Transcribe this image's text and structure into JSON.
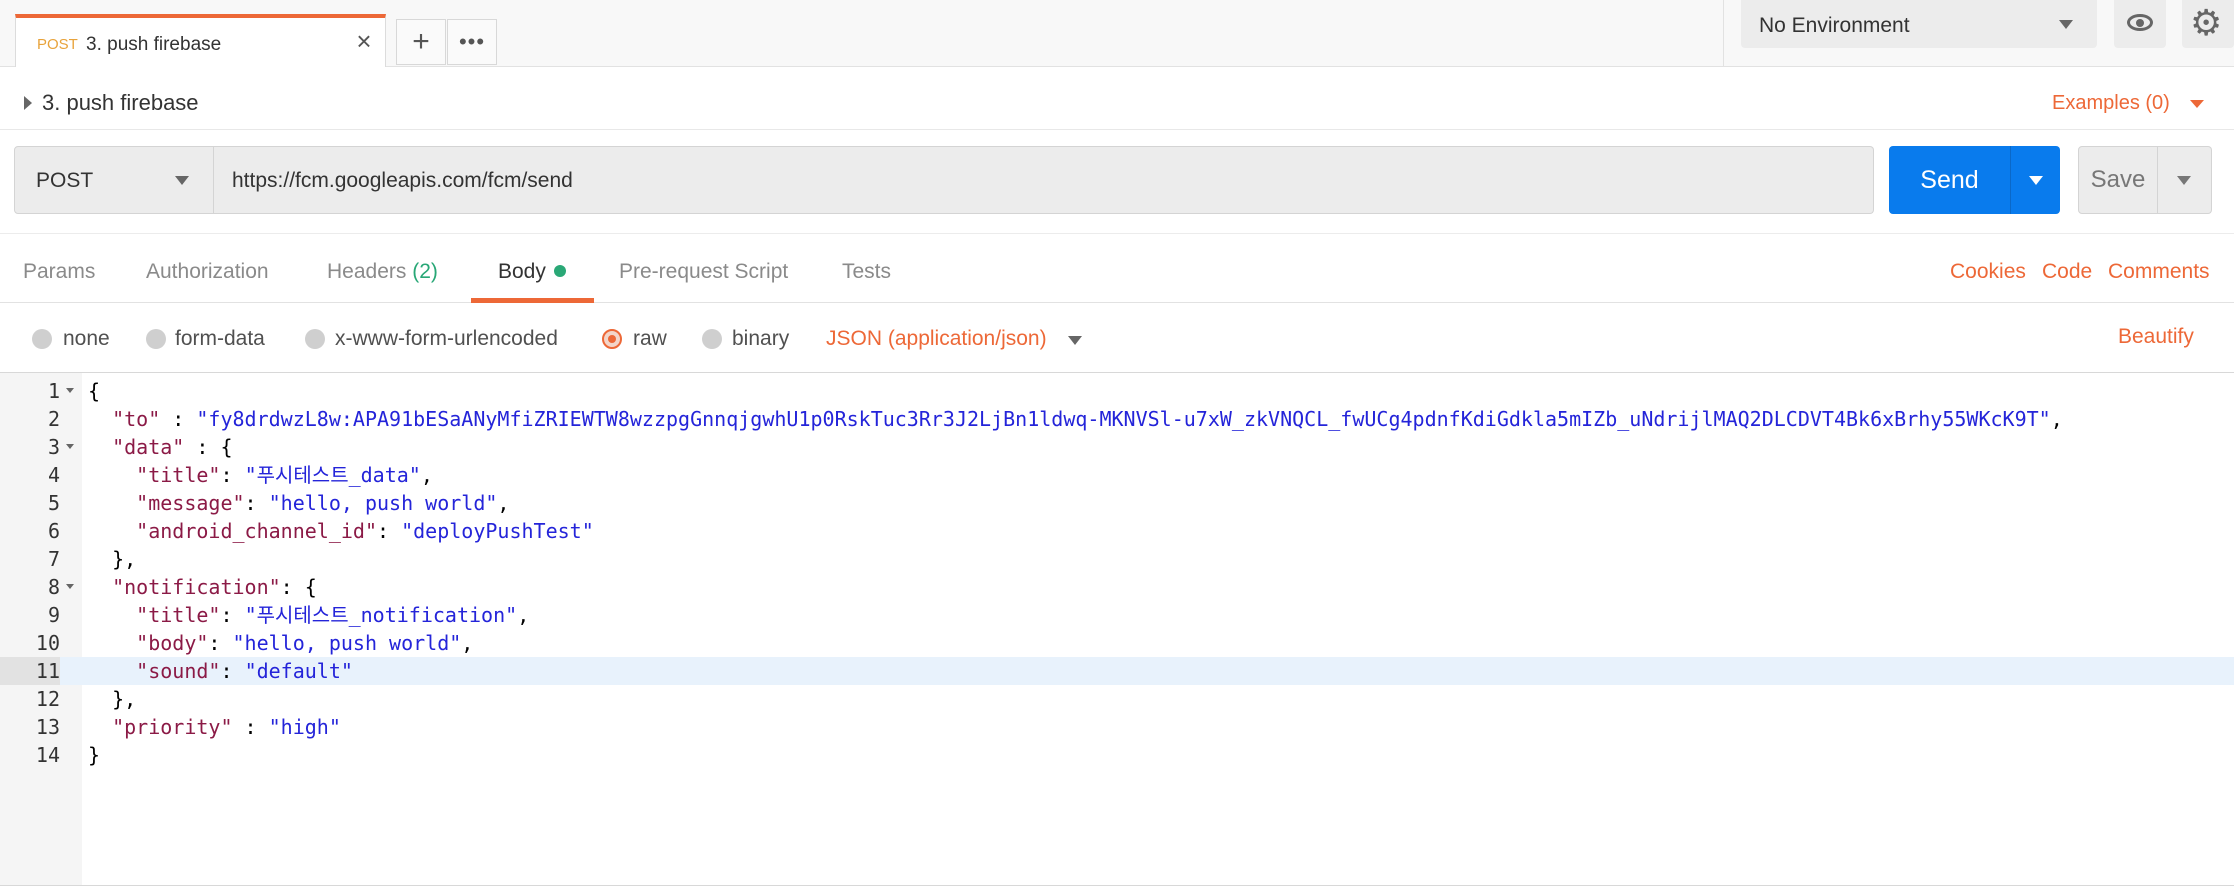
{
  "tab": {
    "method": "POST",
    "name": "3. push firebase"
  },
  "environment": {
    "label": "No Environment"
  },
  "request": {
    "title": "3. push firebase",
    "examples": "Examples (0)",
    "method": "POST",
    "url": "https://fcm.googleapis.com/fcm/send",
    "send": "Send",
    "save": "Save"
  },
  "reqtabs": {
    "params": "Params",
    "authorization": "Authorization",
    "headers": "Headers",
    "headers_count": "(2)",
    "body": "Body",
    "prerequest": "Pre-request Script",
    "tests": "Tests",
    "cookies": "Cookies",
    "code": "Code",
    "comments": "Comments"
  },
  "bodytypes": {
    "none": "none",
    "formdata": "form-data",
    "urlencoded": "x-www-form-urlencoded",
    "raw": "raw",
    "binary": "binary",
    "json": "JSON (application/json)",
    "beautify": "Beautify"
  },
  "editor": {
    "lines": [
      {
        "n": "1",
        "fold": true,
        "parts": [
          [
            "p",
            "{"
          ]
        ]
      },
      {
        "n": "2",
        "fold": false,
        "parts": [
          [
            "p",
            "  "
          ],
          [
            "k",
            "\"to\""
          ],
          [
            "p",
            " : "
          ],
          [
            "s",
            "\"fy8drdwzL8w:APA91bESaANyMfiZRIEWTW8wzzpgGnnqjgwhU1p0RskTuc3Rr3J2LjBn1ldwq-MKNVSl-u7xW_zkVNQCL_fwUCg4pdnfKdiGdkla5mIZb_uNdrijlMAQ2DLCDVT4Bk6xBrhy55WKcK9T\""
          ],
          [
            "p",
            ","
          ]
        ]
      },
      {
        "n": "3",
        "fold": true,
        "parts": [
          [
            "p",
            "  "
          ],
          [
            "k",
            "\"data\""
          ],
          [
            "p",
            " : {"
          ]
        ]
      },
      {
        "n": "4",
        "fold": false,
        "parts": [
          [
            "p",
            "    "
          ],
          [
            "k",
            "\"title\""
          ],
          [
            "p",
            ": "
          ],
          [
            "s",
            "\"푸시테스트_data\""
          ],
          [
            "p",
            ","
          ]
        ]
      },
      {
        "n": "5",
        "fold": false,
        "parts": [
          [
            "p",
            "    "
          ],
          [
            "k",
            "\"message\""
          ],
          [
            "p",
            ": "
          ],
          [
            "s",
            "\"hello, push world\""
          ],
          [
            "p",
            ","
          ]
        ]
      },
      {
        "n": "6",
        "fold": false,
        "parts": [
          [
            "p",
            "    "
          ],
          [
            "k",
            "\"android_channel_id\""
          ],
          [
            "p",
            ": "
          ],
          [
            "s",
            "\"deployPushTest\""
          ]
        ]
      },
      {
        "n": "7",
        "fold": false,
        "parts": [
          [
            "p",
            "  },"
          ]
        ]
      },
      {
        "n": "8",
        "fold": true,
        "parts": [
          [
            "p",
            "  "
          ],
          [
            "k",
            "\"notification\""
          ],
          [
            "p",
            ": {"
          ]
        ]
      },
      {
        "n": "9",
        "fold": false,
        "parts": [
          [
            "p",
            "    "
          ],
          [
            "k",
            "\"title\""
          ],
          [
            "p",
            ": "
          ],
          [
            "s",
            "\"푸시테스트_notification\""
          ],
          [
            "p",
            ","
          ]
        ]
      },
      {
        "n": "10",
        "fold": false,
        "parts": [
          [
            "p",
            "    "
          ],
          [
            "k",
            "\"body\""
          ],
          [
            "p",
            ": "
          ],
          [
            "s",
            "\"hello, push world\""
          ],
          [
            "p",
            ","
          ]
        ]
      },
      {
        "n": "11",
        "fold": false,
        "hl": true,
        "parts": [
          [
            "p",
            "    "
          ],
          [
            "k",
            "\"sound\""
          ],
          [
            "p",
            ": "
          ],
          [
            "s",
            "\"default\""
          ]
        ]
      },
      {
        "n": "12",
        "fold": false,
        "parts": [
          [
            "p",
            "  },"
          ]
        ]
      },
      {
        "n": "13",
        "fold": false,
        "parts": [
          [
            "p",
            "  "
          ],
          [
            "k",
            "\"priority\""
          ],
          [
            "p",
            " : "
          ],
          [
            "s",
            "\"high\""
          ]
        ]
      },
      {
        "n": "14",
        "fold": false,
        "parts": [
          [
            "p",
            "}"
          ]
        ]
      }
    ]
  }
}
